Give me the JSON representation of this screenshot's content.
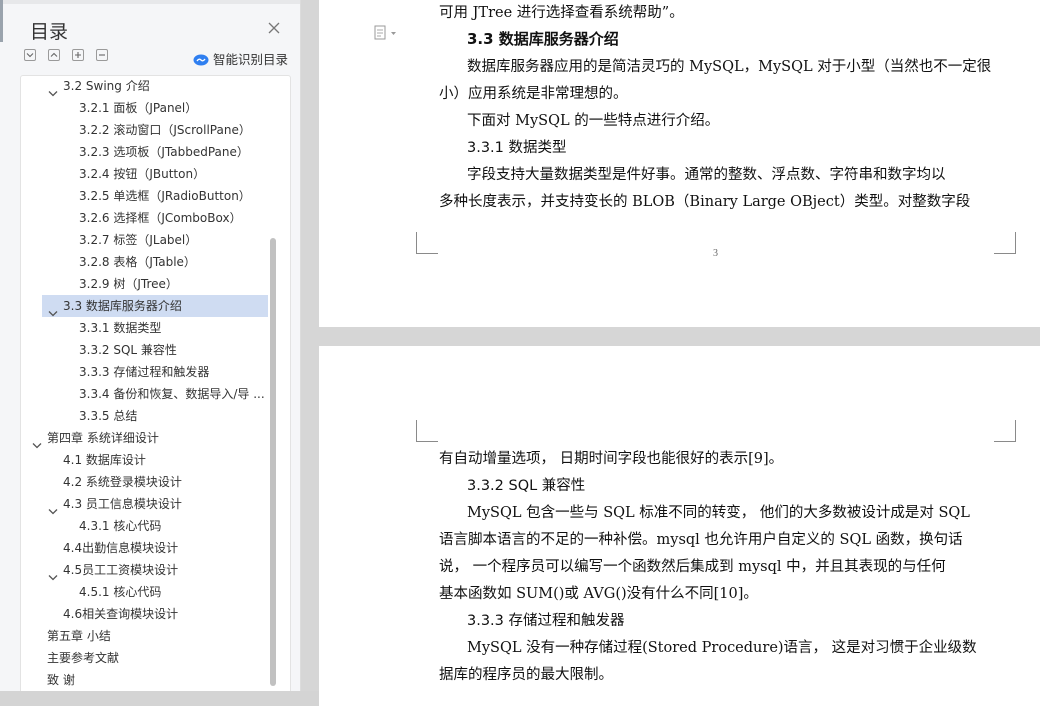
{
  "sidebar": {
    "title": "目录",
    "smart_label": "智能识别目录",
    "toc": [
      {
        "label": "3.2 Swing 介绍",
        "level": 2,
        "caret": "down"
      },
      {
        "label": "3.2.1  面板（JPanel）",
        "level": 3
      },
      {
        "label": "3.2.2  滚动窗口（JScrollPane）",
        "level": 3
      },
      {
        "label": "3.2.3  选项板（JTabbedPane）",
        "level": 3
      },
      {
        "label": "3.2.4  按钮（JButton）",
        "level": 3
      },
      {
        "label": "3.2.5  单选框（JRadioButton）",
        "level": 3
      },
      {
        "label": "3.2.6  选择框（JComboBox）",
        "level": 3
      },
      {
        "label": "3.2.7  标签（JLabel）",
        "level": 3
      },
      {
        "label": "3.2.8  表格（JTable）",
        "level": 3
      },
      {
        "label": "3.2.9  树（JTree）",
        "level": 3
      },
      {
        "label": "3.3  数据库服务器介绍",
        "level": 2,
        "caret": "down",
        "selected": true
      },
      {
        "label": "3.3.1  数据类型",
        "level": 3
      },
      {
        "label": "3.3.2 SQL 兼容性",
        "level": 3
      },
      {
        "label": "3.3.3  存储过程和触发器",
        "level": 3
      },
      {
        "label": "3.3.4  备份和恢复、数据导入/导 ...",
        "level": 3
      },
      {
        "label": "3.3.5  总结",
        "level": 3
      },
      {
        "label": "第四章  系统详细设计",
        "level": 1,
        "caret": "down"
      },
      {
        "label": "4.1  数据库设计",
        "level": 2
      },
      {
        "label": "4.2  系统登录模块设计",
        "level": 2
      },
      {
        "label": "4.3  员工信息模块设计",
        "level": 2,
        "caret": "down"
      },
      {
        "label": "4.3.1 核心代码",
        "level": 3
      },
      {
        "label": "4.4出勤信息模块设计",
        "level": 2
      },
      {
        "label": "4.5员工工资模块设计",
        "level": 2,
        "caret": "down"
      },
      {
        "label": "4.5.1 核心代码",
        "level": 3
      },
      {
        "label": "4.6相关查询模块设计",
        "level": 2
      },
      {
        "label": "第五章  小结",
        "level": 1
      },
      {
        "label": "主要参考文献",
        "level": 1
      },
      {
        "label": "致      谢",
        "level": 1
      }
    ]
  },
  "document": {
    "page1": {
      "lines": [
        {
          "text": "可用 JTree 进行选择查看系统帮助”。",
          "kind": "body",
          "indent": false
        },
        {
          "text": "3.3 数据库服务器介绍",
          "kind": "h",
          "indent": true
        },
        {
          "text": "数据库服务器应用的是简洁灵巧的 MySQL，MySQL 对于小型（当然也不一定很",
          "kind": "body",
          "indent": true
        },
        {
          "text": "小）应用系统是非常理想的。",
          "kind": "body",
          "indent": false
        },
        {
          "text": "下面对 MySQL 的一些特点进行介绍。",
          "kind": "body",
          "indent": true
        },
        {
          "text": "3.3.1 数据类型",
          "kind": "h3",
          "indent": true
        },
        {
          "text": "字段支持大量数据类型是件好事。通常的整数、浮点数、字符串和数字均以",
          "kind": "body",
          "indent": true
        },
        {
          "text": "多种长度表示，并支持变长的 BLOB（Binary Large OBject）类型。对整数字段",
          "kind": "body",
          "indent": false
        }
      ],
      "page_number": "3"
    },
    "page2": {
      "lines": [
        {
          "text": "有自动增量选项， 日期时间字段也能很好的表示[9]。",
          "kind": "body",
          "indent": false
        },
        {
          "text": "3.3.2 SQL 兼容性",
          "kind": "h3",
          "indent": true
        },
        {
          "text": "MySQL 包含一些与 SQL 标准不同的转变， 他们的大多数被设计成是对 SQL",
          "kind": "body",
          "indent": true
        },
        {
          "text": "语言脚本语言的不足的一种补偿。mysql 也允许用户自定义的 SQL 函数，换句话",
          "kind": "body",
          "indent": false
        },
        {
          "text": "说， 一个程序员可以编写一个函数然后集成到 mysql 中，并且其表现的与任何",
          "kind": "body",
          "indent": false
        },
        {
          "text": "基本函数如 SUM()或 AVG()没有什么不同[10]。",
          "kind": "body",
          "indent": false
        },
        {
          "text": "3.3.3 存储过程和触发器",
          "kind": "h3",
          "indent": true
        },
        {
          "text": "MySQL 没有一种存储过程(Stored Procedure)语言， 这是对习惯于企业级数",
          "kind": "body",
          "indent": true
        },
        {
          "text": "据库的程序员的最大限制。",
          "kind": "body",
          "indent": false
        }
      ]
    }
  }
}
